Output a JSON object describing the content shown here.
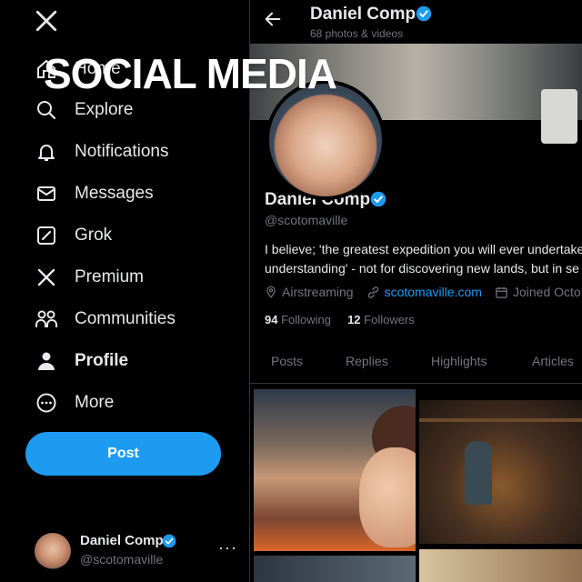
{
  "overlay": {
    "title": "SOCIAL MEDIA"
  },
  "sidebar": {
    "items": [
      {
        "label": "Home",
        "icon": "home-icon"
      },
      {
        "label": "Explore",
        "icon": "search-icon"
      },
      {
        "label": "Notifications",
        "icon": "bell-icon"
      },
      {
        "label": "Messages",
        "icon": "mail-icon"
      },
      {
        "label": "Grok",
        "icon": "grok-icon"
      },
      {
        "label": "Premium",
        "icon": "x-logo-icon"
      },
      {
        "label": "Communities",
        "icon": "people-icon"
      },
      {
        "label": "Profile",
        "icon": "person-icon",
        "active": true
      },
      {
        "label": "More",
        "icon": "more-circle-icon"
      }
    ],
    "post_label": "Post",
    "account": {
      "name": "Daniel Comp",
      "handle": "@scotomaville",
      "more": "···"
    }
  },
  "header": {
    "name": "Daniel Comp",
    "count": "68 photos & videos"
  },
  "profile": {
    "name": "Daniel Comp",
    "handle": "@scotomaville",
    "bio_line1": "I believe; 'the greatest expedition you will ever undertake",
    "bio_line2": "understanding' -  not for discovering new lands, but in se",
    "location": "Airstreaming",
    "website": "scotomaville.com",
    "joined": "Joined Octo",
    "following_count": "94",
    "following_label": "Following",
    "followers_count": "12",
    "followers_label": "Followers"
  },
  "tabs": [
    {
      "label": "Posts"
    },
    {
      "label": "Replies"
    },
    {
      "label": "Highlights"
    },
    {
      "label": "Articles"
    }
  ],
  "colors": {
    "accent": "#1d9bf0",
    "background": "#000000",
    "muted": "#71767b",
    "text": "#e7e9ea"
  }
}
